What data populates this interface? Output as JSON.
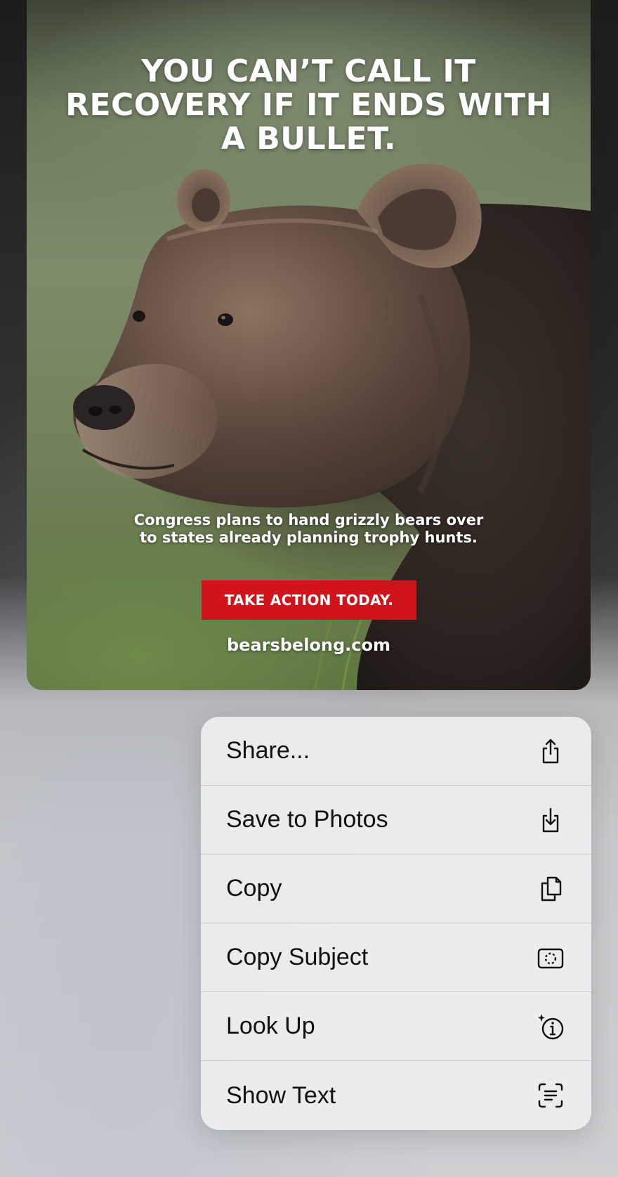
{
  "image": {
    "headline": "YOU CAN’T CALL IT RECOVERY IF IT ENDS WITH A BULLET.",
    "subhead": "Congress plans to hand grizzly bears over to states already planning trophy hunts.",
    "cta": "TAKE ACTION TODAY.",
    "website": "bearsbelong.com"
  },
  "menu": {
    "items": [
      {
        "label": "Share...",
        "icon": "share-icon"
      },
      {
        "label": "Save to Photos",
        "icon": "save-to-photos-icon"
      },
      {
        "label": "Copy",
        "icon": "copy-icon"
      },
      {
        "label": "Copy Subject",
        "icon": "copy-subject-icon"
      },
      {
        "label": "Look Up",
        "icon": "look-up-icon"
      },
      {
        "label": "Show Text",
        "icon": "show-text-icon"
      }
    ]
  },
  "colors": {
    "cta_background": "#d0141b",
    "menu_background": "#ececee",
    "menu_text": "#111111"
  }
}
